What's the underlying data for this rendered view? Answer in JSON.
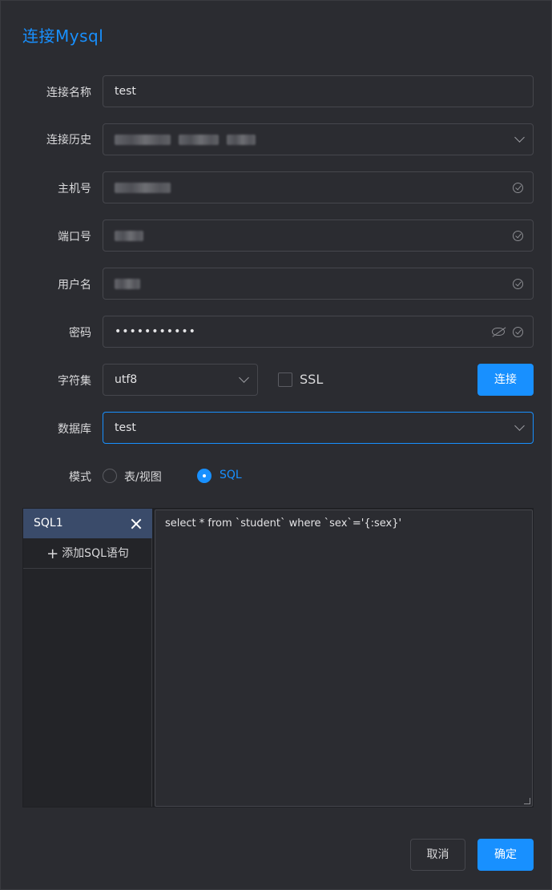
{
  "dialog": {
    "title": "连接Mysql"
  },
  "form": {
    "conn_name": {
      "label": "连接名称",
      "value": "test"
    },
    "conn_history": {
      "label": "连接历史"
    },
    "host": {
      "label": "主机号"
    },
    "port": {
      "label": "端口号"
    },
    "username": {
      "label": "用户名"
    },
    "password": {
      "label": "密码",
      "value": "•••••••••••"
    },
    "charset": {
      "label": "字符集",
      "value": "utf8"
    },
    "ssl": {
      "label": "SSL",
      "checked": false
    },
    "connect_button": "连接",
    "database": {
      "label": "数据库",
      "value": "test"
    },
    "mode": {
      "label": "模式",
      "options": [
        "表/视图",
        "SQL"
      ],
      "selected": "SQL"
    }
  },
  "sql": {
    "tabs": [
      {
        "label": "SQL1"
      }
    ],
    "add_label": "添加SQL语句",
    "query": "select * from `student` where `sex`='{:sex}'"
  },
  "footer": {
    "cancel": "取消",
    "ok": "确定"
  },
  "colors": {
    "accent": "#1890ff",
    "background": "#2b2c31",
    "tab_active": "#3a4b6a"
  },
  "icons": [
    "check-circle-icon",
    "chevron-down-icon",
    "eye-off-icon",
    "close-icon",
    "plus-icon"
  ]
}
